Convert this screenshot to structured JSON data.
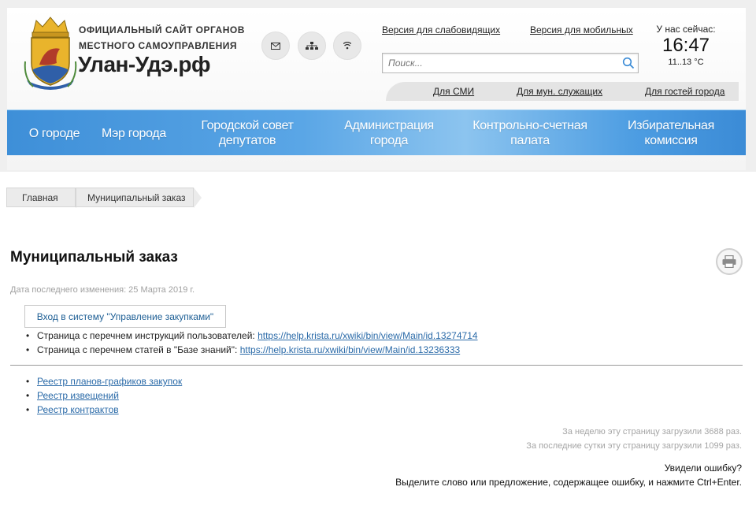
{
  "header": {
    "subtitle_line1": "Официальный сайт органов",
    "subtitle_line2": "местного самоуправления",
    "site_name": "Улан-Удэ.рф",
    "icons": [
      "mail-icon",
      "sitemap-icon",
      "rss-icon"
    ],
    "link_low_vision": "Версия для слабовидящих",
    "link_mobile": "Версия для мобильных",
    "search_placeholder": "Поиск...",
    "now_label": "У нас сейчас:",
    "now_time": "16:47",
    "now_temp": "11..13 °C",
    "audience_links": [
      "Для СМИ",
      "Для мун. служащих",
      "Для гостей города"
    ]
  },
  "nav": {
    "items": [
      {
        "line1": "О городе",
        "line2": ""
      },
      {
        "line1": "Мэр города",
        "line2": ""
      },
      {
        "line1": "Городской совет",
        "line2": "депутатов"
      },
      {
        "line1": "Администрация",
        "line2": "города"
      },
      {
        "line1": "Контрольно-счетная",
        "line2": "палата"
      },
      {
        "line1": "Избирательная",
        "line2": "комиссия"
      }
    ]
  },
  "breadcrumb": {
    "home": "Главная",
    "current": "Муниципальный заказ"
  },
  "main": {
    "title": "Муниципальный заказ",
    "updated": "Дата последнего изменения: 25 Марта 2019 г.",
    "login_button": "Вход в систему \"Управление закупками\"",
    "instructions_text": "Страница с перечнем инструкций пользователей: ",
    "instructions_link": "https://help.krista.ru/xwiki/bin/view/Main/id.13274714",
    "kb_text": "Страница с перечнем статей в \"Базе знаний\": ",
    "kb_link": "https://help.krista.ru/xwiki/bin/view/Main/id.13236333",
    "registers": [
      "Реестр планов-графиков закупок",
      "Реестр извещений",
      "Реестр контрактов"
    ]
  },
  "stats": {
    "week": "За неделю эту страницу загрузили 3688 раз.",
    "day": "За последние сутки эту страницу загрузили 1099 раз."
  },
  "error_notice": {
    "line1": "Увидели ошибку?",
    "line2": "Выделите слово или предложение, содержащее ошибку, и нажмите Ctrl+Enter."
  },
  "colors": {
    "nav_blue": "#4d9de2",
    "link_blue": "#2a6aa8",
    "emblem_gold": "#e9b42c",
    "emblem_blue": "#2f5fa8"
  }
}
